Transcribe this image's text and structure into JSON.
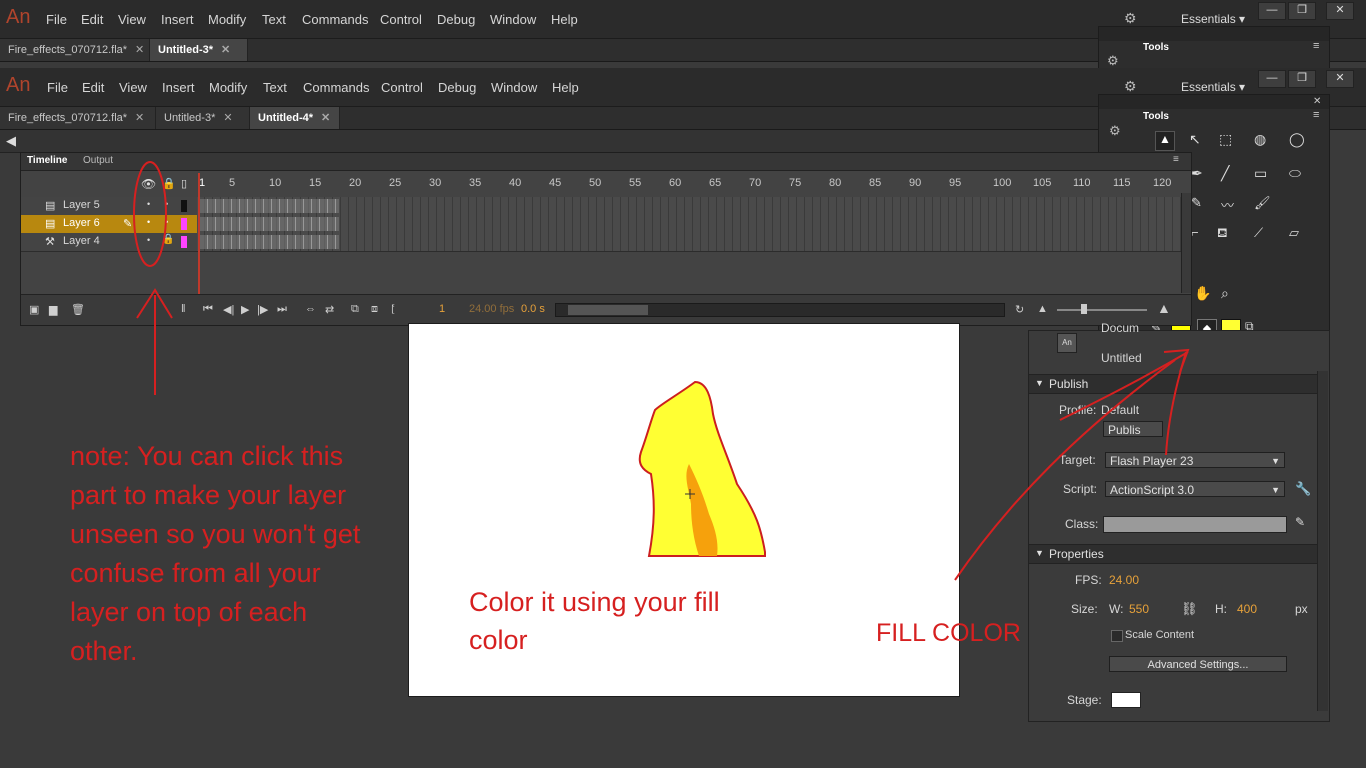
{
  "app": {
    "logo": "An",
    "menu": [
      "File",
      "Edit",
      "View",
      "Insert",
      "Modify",
      "Text",
      "Commands",
      "Control",
      "Debug",
      "Window",
      "Help"
    ],
    "workspace": "Essentials",
    "window_controls": [
      "—",
      "❐",
      "✕"
    ]
  },
  "back_window": {
    "tabs": [
      {
        "label": "Fire_effects_070712.fla*",
        "close": "✕"
      },
      {
        "label": "Untitled-3*",
        "close": "✕"
      }
    ],
    "tools_title": "Tools"
  },
  "front_window": {
    "tabs": [
      {
        "label": "Fire_effects_070712.fla*",
        "close": "✕"
      },
      {
        "label": "Untitled-3*",
        "close": "✕"
      },
      {
        "label": "Untitled-4*",
        "close": "✕"
      }
    ],
    "tools_title": "Tools"
  },
  "timeline": {
    "tabs": [
      "Timeline",
      "Output"
    ],
    "frame_numbers": [
      "1",
      "5",
      "10",
      "15",
      "20",
      "25",
      "30",
      "35",
      "40",
      "45",
      "50",
      "55",
      "60",
      "65",
      "70",
      "75",
      "80",
      "85",
      "90",
      "95",
      "100",
      "105",
      "110",
      "115",
      "120"
    ],
    "layers": [
      {
        "name": "Layer 5",
        "selected": false,
        "color": "#111111"
      },
      {
        "name": "Layer 6",
        "selected": true,
        "color": "#ff44ff"
      },
      {
        "name": "Layer 4",
        "selected": false,
        "color": "#ff44ff"
      }
    ],
    "current_frame": "1",
    "fps": "24.00 fps",
    "time": "0.0 s"
  },
  "tools_panel": {
    "stroke_color": "#ffff00",
    "fill_color": "#ffff33"
  },
  "properties": {
    "document_label": "Docum",
    "untitled_label": "Untitled",
    "publish_section": "Publish",
    "profile_label": "Profile:",
    "profile_value": "Default",
    "publish_button": "Publis",
    "target_label": "Target:",
    "target_value": "Flash Player 23",
    "script_label": "Script:",
    "script_value": "ActionScript 3.0",
    "class_label": "Class:",
    "properties_section": "Properties",
    "fps_label": "FPS:",
    "fps_value": "24.00",
    "size_label": "Size:",
    "w_label": "W:",
    "w_value": "550",
    "h_label": "H:",
    "h_value": "400",
    "unit": "px",
    "scale_content": "Scale Content",
    "advanced_settings": "Advanced Settings...",
    "stage_label": "Stage:",
    "stage_color": "#ffffff"
  },
  "annotations": {
    "note": [
      "note: You can click this",
      "part to make your layer",
      "unseen so you won't get",
      "confuse from all your",
      "layer on top of each",
      "other."
    ],
    "color_it": [
      "Color it using your fill",
      "color"
    ],
    "fill_color": "FILL COLOR",
    "annotation_color": "#d62020"
  }
}
